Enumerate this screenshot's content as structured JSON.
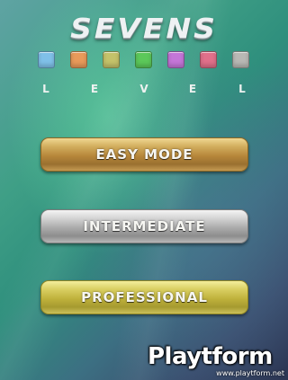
{
  "game": {
    "title": "SEVENS"
  },
  "color_swatches": [
    {
      "icon": "blue-swatch",
      "color": "#7fc0e8"
    },
    {
      "icon": "orange-swatch",
      "color": "#e89a5a"
    },
    {
      "icon": "olive-swatch",
      "color": "#c4c26a"
    },
    {
      "icon": "green-swatch",
      "color": "#5cc85a"
    },
    {
      "icon": "purple-swatch",
      "color": "#c476d8"
    },
    {
      "icon": "pink-swatch",
      "color": "#e0708a"
    },
    {
      "icon": "gray-swatch",
      "color": "#b8b8b4"
    }
  ],
  "level_letters": [
    "L",
    "E",
    "V",
    "E",
    "L"
  ],
  "modes": {
    "easy": "EASY MODE",
    "intermediate": "INTERMEDIATE",
    "professional": "PROFESSIONAL"
  },
  "watermark": {
    "logo": "Playtform",
    "url": "www.playtform.net"
  }
}
